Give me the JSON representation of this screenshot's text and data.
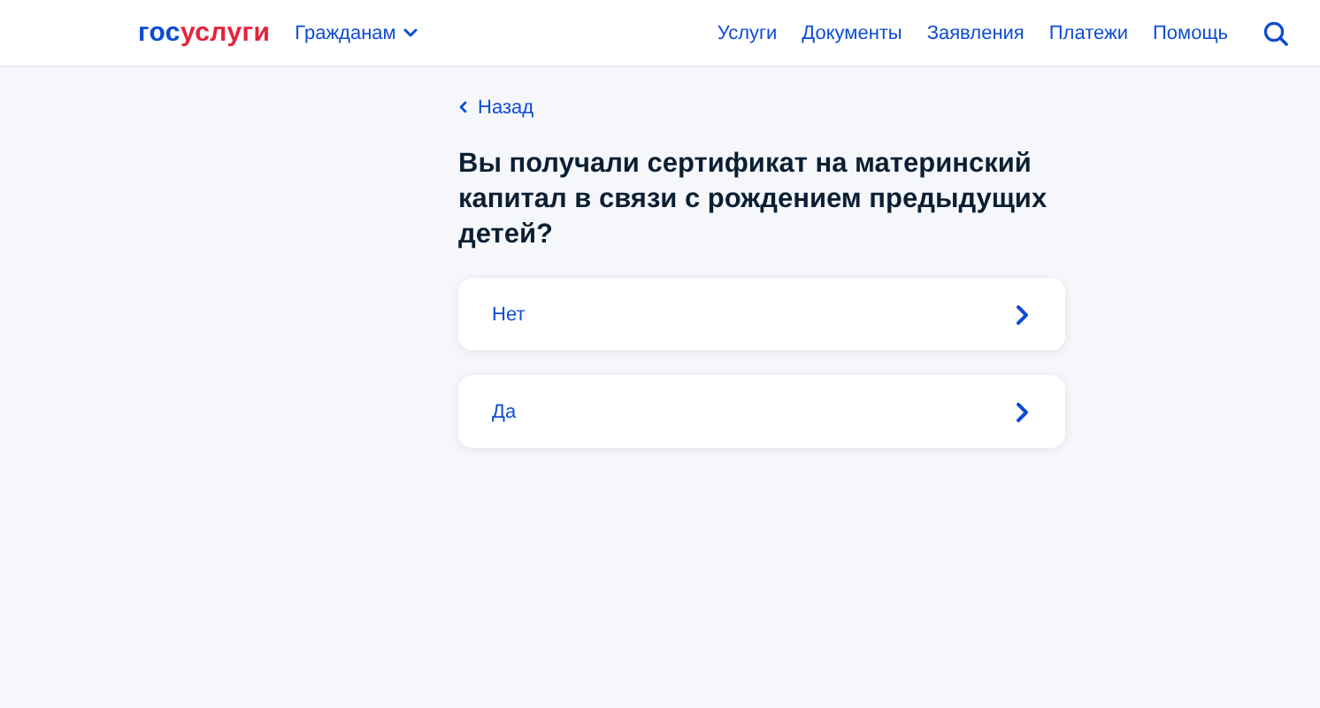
{
  "header": {
    "logo": [
      {
        "text": "гос",
        "color": "#0d4cd3"
      },
      {
        "text": "услуги",
        "color": "#e4233b"
      }
    ],
    "audience_menu": {
      "label": "Гражданам",
      "expanded": false
    },
    "nav": [
      "Услуги",
      "Документы",
      "Заявления",
      "Платежи",
      "Помощь"
    ]
  },
  "back_link": "Назад",
  "question": "Вы получали сертификат на материнский капитал в связи с рождением предыдущих детей?",
  "answers": [
    "Нет",
    "Да"
  ]
}
